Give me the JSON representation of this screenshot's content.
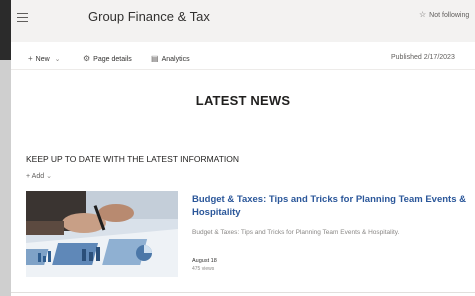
{
  "header": {
    "site_title": "Group Finance & Tax",
    "follow_label": "Not following"
  },
  "command_bar": {
    "new_label": "New",
    "page_details_label": "Page details",
    "analytics_label": "Analytics",
    "published_label": "Published 2/17/2023"
  },
  "section": {
    "title": "LATEST NEWS"
  },
  "news": {
    "heading": "KEEP UP TO DATE WITH THE LATEST INFORMATION",
    "add_label": "Add",
    "item": {
      "title_line1": "Budget & Taxes: Tips and Tricks for Planning Team Events &",
      "title_line2": "Hospitality",
      "description": "Budget & Taxes: Tips and Tricks for Planning Team Events & Hospitality.",
      "date": "August 18",
      "views": "475 views"
    }
  },
  "icons": {
    "menu": "hamburger-icon",
    "follow": "star-icon",
    "new": "plus-icon",
    "page_details": "gear-icon",
    "analytics": "chart-icon",
    "add": "plus-icon"
  }
}
